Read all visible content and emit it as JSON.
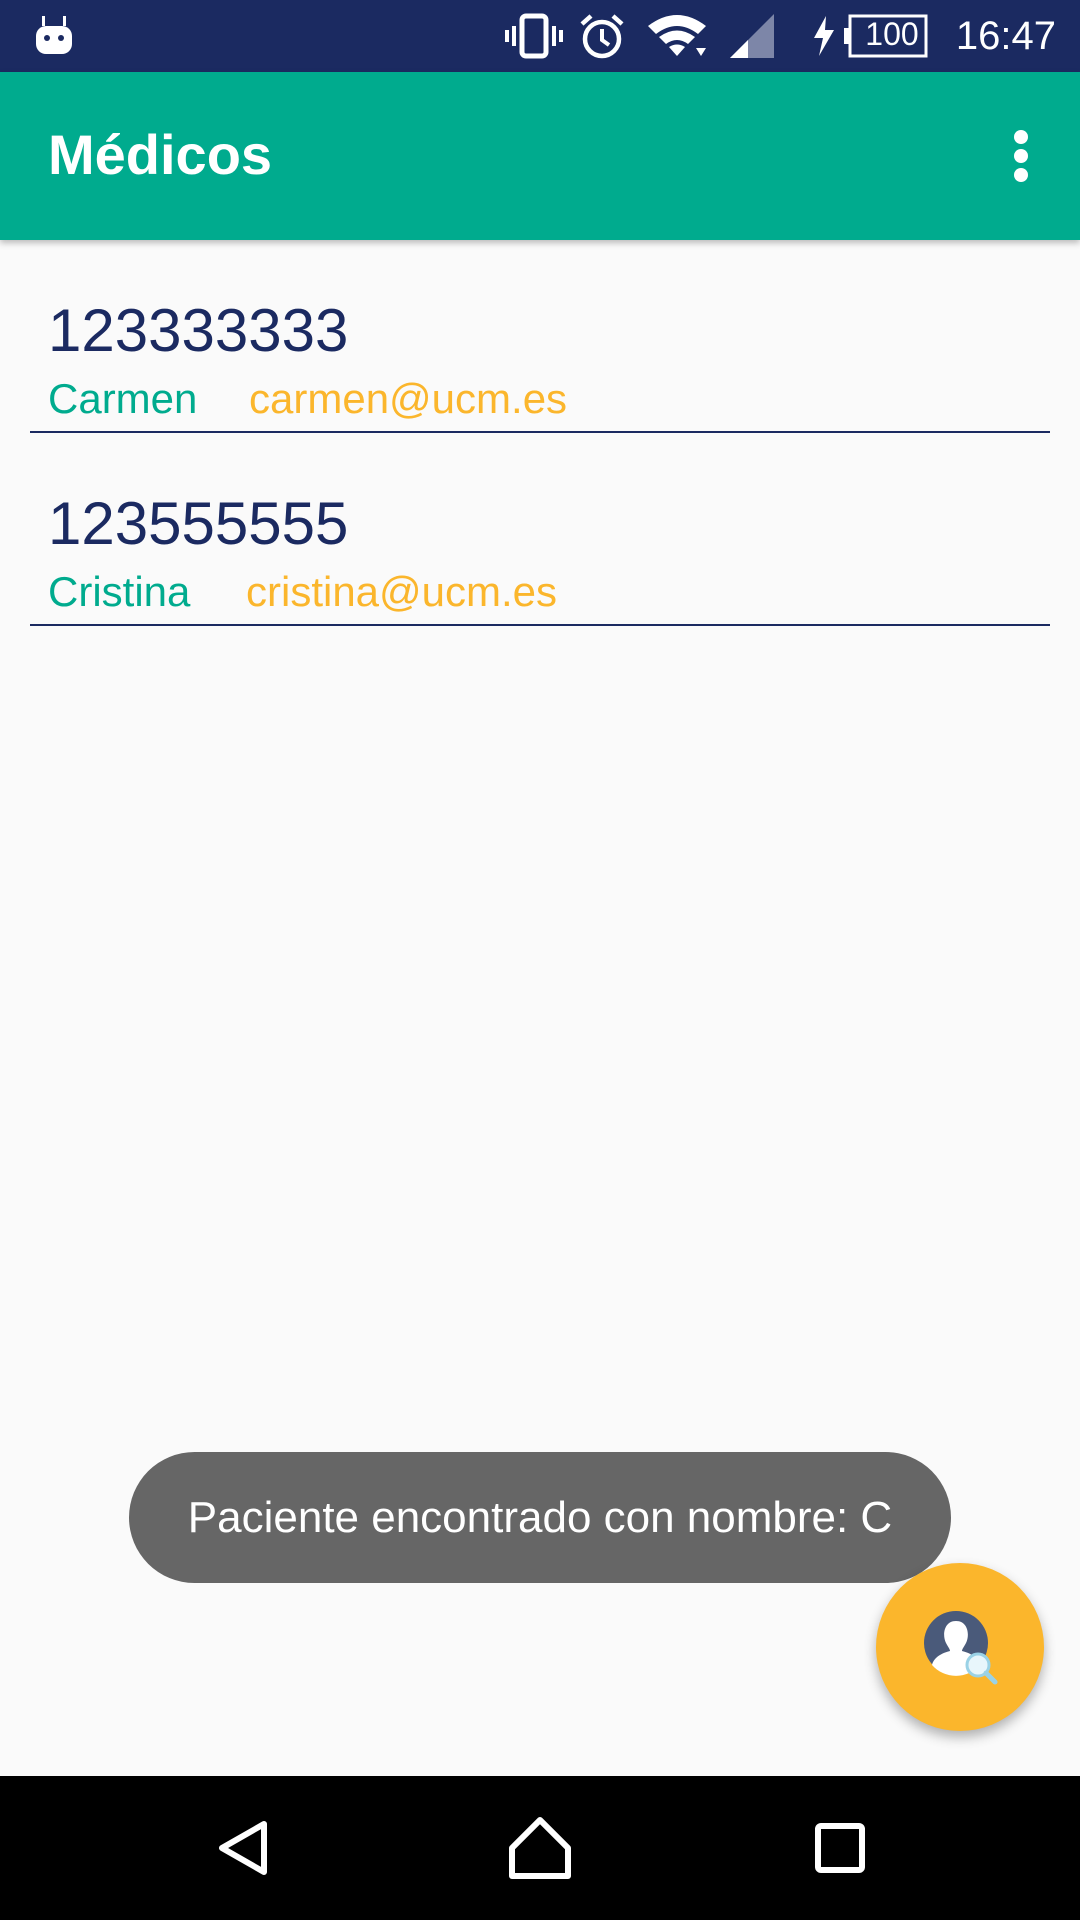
{
  "status_bar": {
    "notification_icon": "android-debug-icon",
    "icons": [
      "vibrate-icon",
      "alarm-icon",
      "wifi-icon",
      "cell-signal-icon",
      "battery-charging-icon"
    ],
    "battery_level": "100",
    "time": "16:47",
    "background_color": "#1b2a61"
  },
  "app_bar": {
    "title": "Médicos",
    "overflow_icon": "more-vert-icon",
    "background_color": "#00ab8e"
  },
  "doctors": [
    {
      "phone": "123333333",
      "name": "Carmen",
      "email": "carmen@ucm.es"
    },
    {
      "phone": "123555555",
      "name": "Cristina",
      "email": "cristina@ucm.es"
    }
  ],
  "toast": {
    "message": "Paciente encontrado con nombre: C"
  },
  "fab": {
    "icon": "search-person-icon",
    "color": "#fbb62c"
  },
  "nav_bar": {
    "buttons": [
      "back-icon",
      "home-icon",
      "recents-icon"
    ]
  },
  "colors": {
    "primary": "#00ab8e",
    "primary_dark": "#1b2a61",
    "accent": "#fbb62c"
  }
}
